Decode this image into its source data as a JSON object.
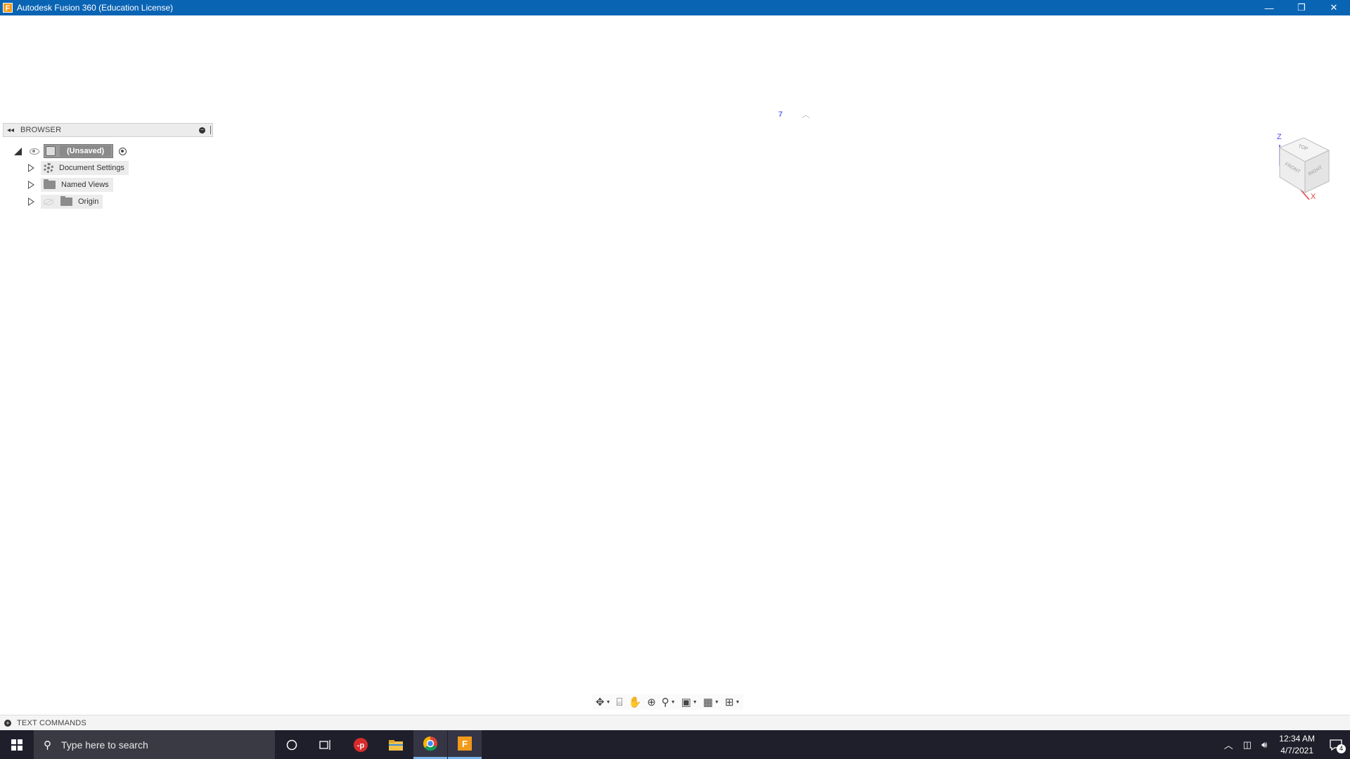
{
  "window": {
    "title": "Autodesk Fusion 360 (Education License)",
    "app_icon_letter": "F",
    "minimize": "—",
    "restore": "❐",
    "close": "✕"
  },
  "browser": {
    "collapse_glyph": "◂◂",
    "title": "BROWSER",
    "minus_glyph": "−",
    "root_label": "(Unsaved)",
    "items": [
      {
        "label": "Document Settings",
        "icon": "gear-icon"
      },
      {
        "label": "Named Views",
        "icon": "folder-icon"
      },
      {
        "label": "Origin",
        "icon": "folder-icon"
      }
    ]
  },
  "viewport": {
    "mark": "7",
    "caret": "︿"
  },
  "viewcube": {
    "top": "TOP",
    "front": "FRONT",
    "right": "RIGHT",
    "axis_z": "Z",
    "axis_x": "X"
  },
  "nav_toolbar": {
    "icons": [
      "orbit-icon",
      "look-at-icon",
      "pan-icon",
      "zoom-icon",
      "fit-icon",
      "display-settings-icon",
      "grid-icon",
      "viewports-icon"
    ]
  },
  "text_commands": {
    "expand_glyph": "+",
    "label": "TEXT COMMANDS"
  },
  "taskbar": {
    "search_placeholder": "Type here to search",
    "time": "12:34 AM",
    "date": "4/7/2021",
    "notification_count": "4",
    "accent": "#7ab4ea"
  }
}
